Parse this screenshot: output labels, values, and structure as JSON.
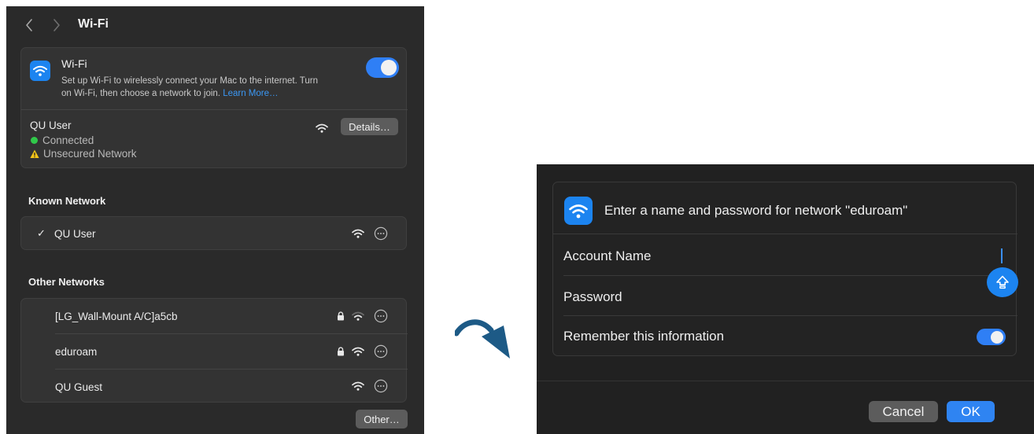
{
  "left_window": {
    "title": "Wi-Fi",
    "wifi_card": {
      "label": "Wi-Fi",
      "description": "Set up Wi-Fi to wirelessly connect your Mac to the internet. Turn on Wi-Fi, then choose a network to join.",
      "learn_more": "Learn More…",
      "toggle_on": true
    },
    "current_network": {
      "name": "QU User",
      "connected": "Connected",
      "unsecured": "Unsecured Network",
      "details_button": "Details…"
    },
    "known_header": "Known Network",
    "known_networks": [
      {
        "check": "✓",
        "name": "QU User"
      }
    ],
    "other_header": "Other Networks",
    "other_networks": [
      {
        "name": "[LG_Wall-Mount A/C]a5cb",
        "locked": true
      },
      {
        "name": "eduroam",
        "locked": true
      },
      {
        "name": "QU Guest",
        "locked": false
      }
    ],
    "other_button": "Other…"
  },
  "dialog": {
    "prompt": "Enter a name and password for network \"eduroam\"",
    "account_label": "Account Name",
    "password_label": "Password",
    "remember_label": "Remember this information",
    "remember_on": true,
    "cancel_button": "Cancel",
    "ok_button": "OK"
  },
  "colors": {
    "accent": "#2f7ff5",
    "panel_bg": "#2a2a2a",
    "dialog_bg": "#212121",
    "arrow": "#1d5a86",
    "connected_dot": "#30c94a",
    "warning": "#f5c518"
  },
  "icons": [
    "chevron-left-icon",
    "chevron-right-icon",
    "wifi-icon",
    "lock-icon",
    "more-icon",
    "warning-icon",
    "caps-lock-icon",
    "curved-arrow-icon"
  ]
}
